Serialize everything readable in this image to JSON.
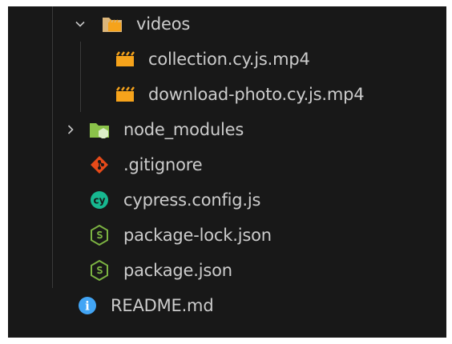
{
  "explorer": {
    "items": [
      {
        "label": "videos",
        "kind": "folder",
        "expanded": true,
        "icon": "video-folder-icon"
      },
      {
        "label": "collection.cy.js.mp4",
        "kind": "file",
        "icon": "video-file-icon"
      },
      {
        "label": "download-photo.cy.js.mp4",
        "kind": "file",
        "icon": "video-file-icon"
      },
      {
        "label": "node_modules",
        "kind": "folder",
        "expanded": false,
        "icon": "node-folder-icon"
      },
      {
        "label": ".gitignore",
        "kind": "file",
        "icon": "git-icon"
      },
      {
        "label": "cypress.config.js",
        "kind": "file",
        "icon": "cypress-icon"
      },
      {
        "label": "package-lock.json",
        "kind": "file",
        "icon": "nodejs-icon"
      },
      {
        "label": "package.json",
        "kind": "file",
        "icon": "nodejs-icon"
      },
      {
        "label": "README.md",
        "kind": "file",
        "icon": "info-icon"
      }
    ],
    "icon_text": {
      "cypress": "cy",
      "info": "i"
    },
    "colors": {
      "background": "#181818",
      "text": "#cccccc",
      "folder": "#dcb67a",
      "video": "#f6a31b",
      "node_folder": "#8bc34a",
      "git": "#e64a19",
      "cypress": "#17b890",
      "nodejs": "#7cb342",
      "info": "#42a5f5"
    }
  }
}
